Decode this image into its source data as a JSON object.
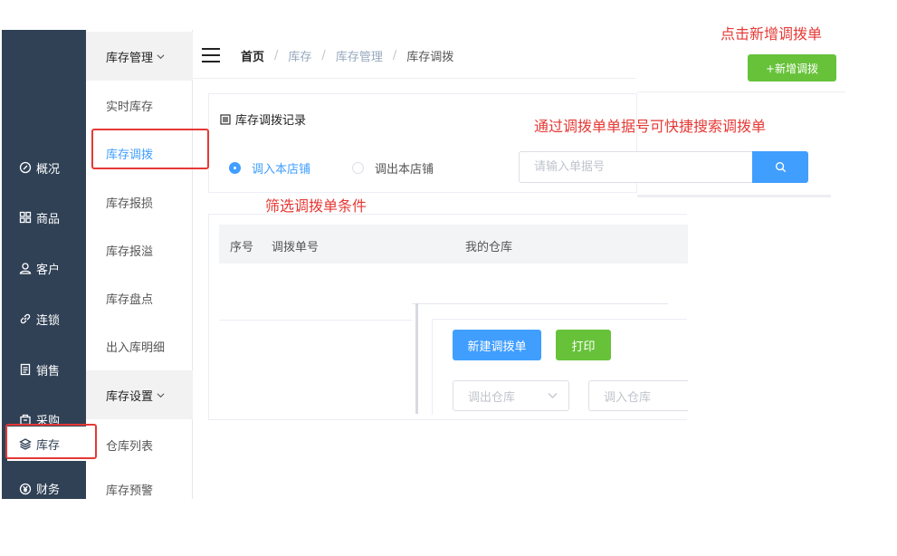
{
  "sidebar": {
    "items": [
      {
        "label": "概况",
        "icon": "gauge-icon"
      },
      {
        "label": "商品",
        "icon": "grid-icon"
      },
      {
        "label": "客户",
        "icon": "user-icon"
      },
      {
        "label": "连锁",
        "icon": "link-icon"
      },
      {
        "label": "销售",
        "icon": "document-icon"
      },
      {
        "label": "采购",
        "icon": "bag-icon"
      },
      {
        "label": "库存",
        "icon": "layers-icon"
      },
      {
        "label": "财务",
        "icon": "yen-icon"
      }
    ]
  },
  "submenu": {
    "group1": "库存管理",
    "items1": [
      "实时库存",
      "库存调拨",
      "库存报损",
      "库存报溢",
      "库存盘点",
      "出入库明细"
    ],
    "group2": "库存设置",
    "items2": [
      "仓库列表",
      "库存预警"
    ]
  },
  "breadcrumb": {
    "home": "首页",
    "level1": "库存",
    "level2": "库存管理",
    "current": "库存调拨",
    "separator": "/"
  },
  "header": {
    "add_button": "+新增调拨"
  },
  "record": {
    "title": "库存调拨记录",
    "radio_in": "调入本店铺",
    "radio_out": "调出本店铺",
    "search_placeholder": "请输入单据号"
  },
  "table": {
    "columns": [
      "序号",
      "调拨单号",
      "我的仓库"
    ]
  },
  "dialog": {
    "new_button": "新建调拨单",
    "print_button": "打印",
    "from_placeholder": "调出仓库",
    "to_placeholder": "调入仓库"
  },
  "annotations": {
    "add_note": "点击新增调拨单",
    "search_note": "通过调拨单单据号可快捷搜索调拨单",
    "filter_note": "筛选调拨单条件"
  },
  "colors": {
    "sidebar": "#304156",
    "primary": "#409eff",
    "success": "#67c23a",
    "annotation": "#e53935"
  }
}
